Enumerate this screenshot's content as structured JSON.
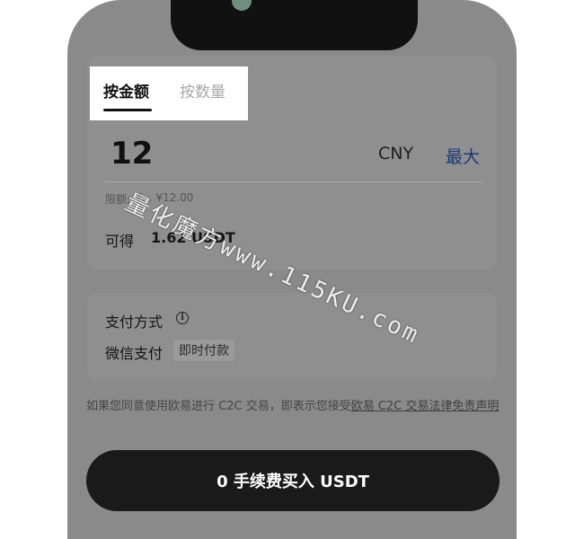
{
  "tabs": [
    {
      "label": "按金额",
      "active": true
    },
    {
      "label": "按数量",
      "active": false
    }
  ],
  "amount_input": {
    "value": "12"
  },
  "currency": "CNY",
  "max_label": "最大",
  "limit": {
    "label": "限额:",
    "range": "¥… ¥12.00"
  },
  "receive": {
    "label": "可得",
    "value": "1.62 USDT"
  },
  "payment": {
    "title": "支付方式",
    "info_icon": "info-icon",
    "method": "微信支付",
    "tag": "即时付款"
  },
  "disclaimer": {
    "text": "如果您同意使用欧易进行 C2C 交易，即表示您接受",
    "link": "欧易 C2C 交易法律免责声明"
  },
  "buy_button": "0 手续费买入 USDT",
  "watermark": {
    "cn": "量化魔方",
    "url": "www.115KU.com"
  },
  "colors": {
    "accent_blue": "#1b3a7a",
    "button_bg": "#1a1a1a",
    "overlay_gray": "#8a8a8a"
  }
}
